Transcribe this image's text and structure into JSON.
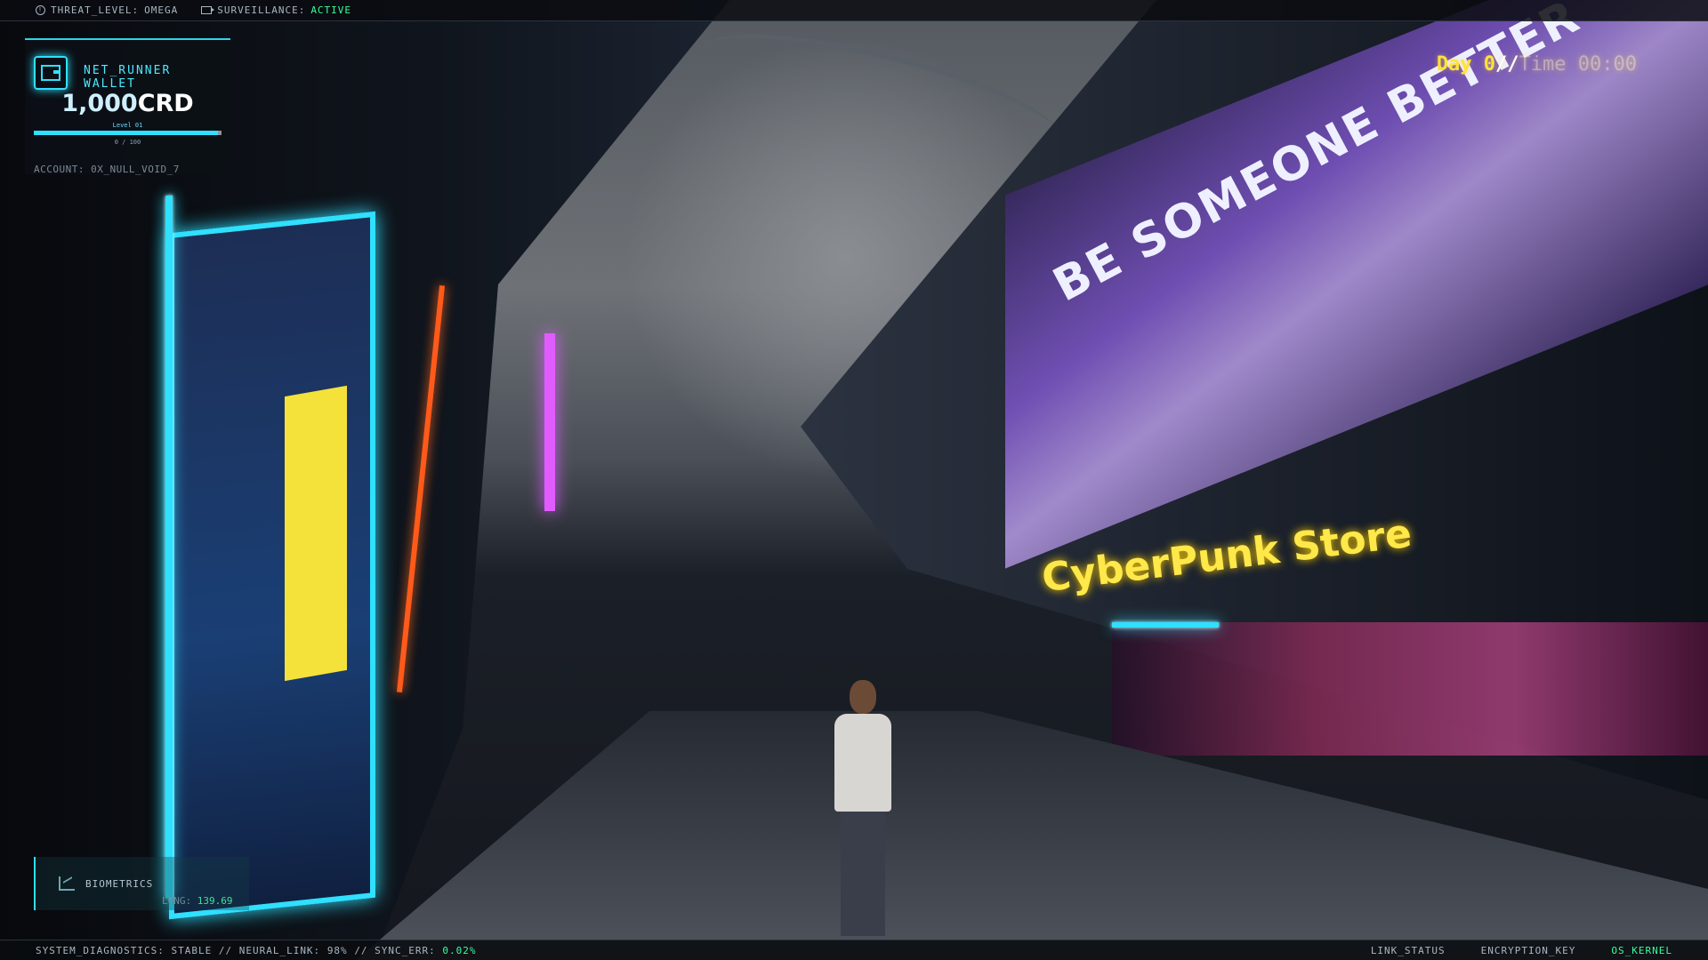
{
  "status_bar": {
    "threat_label": "THREAT_LEVEL:",
    "threat_value": "OMEGA",
    "surveillance_label": "SURVEILLANCE:",
    "surveillance_value": "ACTIVE"
  },
  "wallet": {
    "title": "NET_RUNNER WALLET",
    "amount": "1,000",
    "currency": "CRD",
    "level_label": "Level 01",
    "level_progress_text": "0 / 100",
    "level_progress": 0.98,
    "account": "ACCOUNT: 0X_NULL_VOID_7"
  },
  "clock": {
    "day_label": "Day 0",
    "separator": "//",
    "time_label": "Time 00:00"
  },
  "scene": {
    "billboard_text": "BE SOMEONE BETTER",
    "store_sign": "CyberPunk Store"
  },
  "biometrics": {
    "title": "BIOMETRICS",
    "long_label": "LONG:",
    "long_value": "139.69"
  },
  "footer": {
    "diag_label": "SYSTEM_DIAGNOSTICS:",
    "diag_value": "STABLE",
    "neural_label": "// NEURAL_LINK:",
    "neural_value": "98%",
    "sync_label": "// SYNC_ERR:",
    "sync_value": "0.02%",
    "links": [
      "LINK_STATUS",
      "ENCRYPTION_KEY",
      "OS_KERNEL"
    ]
  },
  "colors": {
    "accent_cyan": "#2fe0ff",
    "status_green": "#38ff9c",
    "clock_yellow": "#ffe23a"
  }
}
